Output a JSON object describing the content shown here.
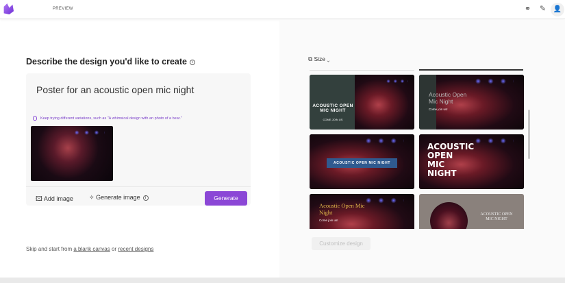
{
  "header": {
    "badge": "PREVIEW"
  },
  "main": {
    "title": "Describe the design you'd like to create",
    "prompt": "Poster for an acoustic open mic night",
    "hint": "Keep trying different variations, such as \"A whimsical design with an photo of a bear.\"",
    "add_image": "Add image",
    "generate_image": "Generate image",
    "generate": "Generate",
    "skip_prefix": "Skip and start from",
    "blank_canvas": "a blank canvas",
    "or": "or",
    "recent_designs": "recent designs"
  },
  "results": {
    "size_label": "Size",
    "customize": "Customize design",
    "designs": [
      {
        "title": "ACOUSTIC OPEN MIC NIGHT",
        "sub": "COME JOIN US"
      },
      {
        "title": "Acoustic Open Mic Night",
        "sub": "Come join us!"
      },
      {
        "title": "ACOUSTIC OPEN MIC NIGHT"
      },
      {
        "title": "ACOUSTIC OPEN MIC NIGHT"
      },
      {
        "title": "Acoustic Open Mic Night",
        "sub": "Come join us!"
      },
      {
        "title": "ACOUSTIC OPEN MIC NIGHT"
      }
    ]
  },
  "colors": {
    "accent": "#8b47d6"
  }
}
